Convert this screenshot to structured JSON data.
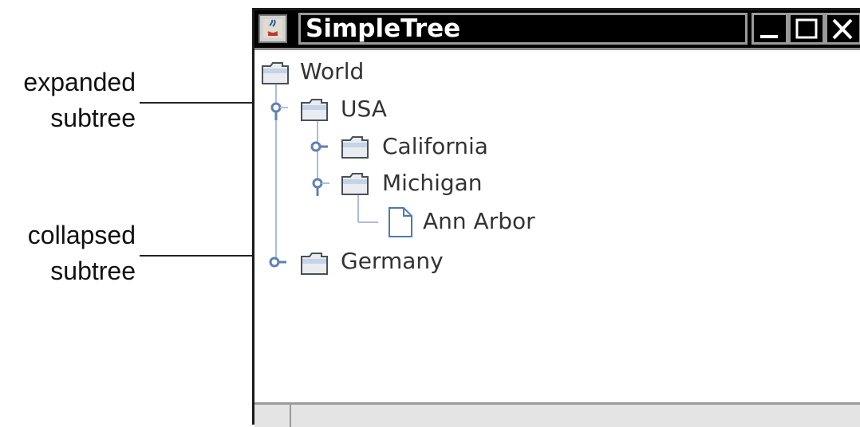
{
  "annotations": {
    "expanded": {
      "line1": "expanded",
      "line2": "subtree"
    },
    "collapsed": {
      "line1": "collapsed",
      "line2": "subtree"
    }
  },
  "window": {
    "title": "SimpleTree",
    "controls": [
      "minimize",
      "maximize",
      "close"
    ]
  },
  "tree": {
    "root": {
      "label": "World",
      "icon": "folder-icon"
    },
    "usa": {
      "label": "USA",
      "icon": "folder-icon",
      "expanded": true
    },
    "california": {
      "label": "California",
      "icon": "folder-icon",
      "expanded": false
    },
    "michigan": {
      "label": "Michigan",
      "icon": "folder-icon",
      "expanded": true
    },
    "ann_arbor": {
      "label": "Ann Arbor",
      "icon": "document-icon"
    },
    "germany": {
      "label": "Germany",
      "icon": "folder-icon",
      "expanded": false
    }
  },
  "colors": {
    "connector": "#a9bedc",
    "toggle": "#5f80b4",
    "folder_outline": "#4a4f57"
  }
}
